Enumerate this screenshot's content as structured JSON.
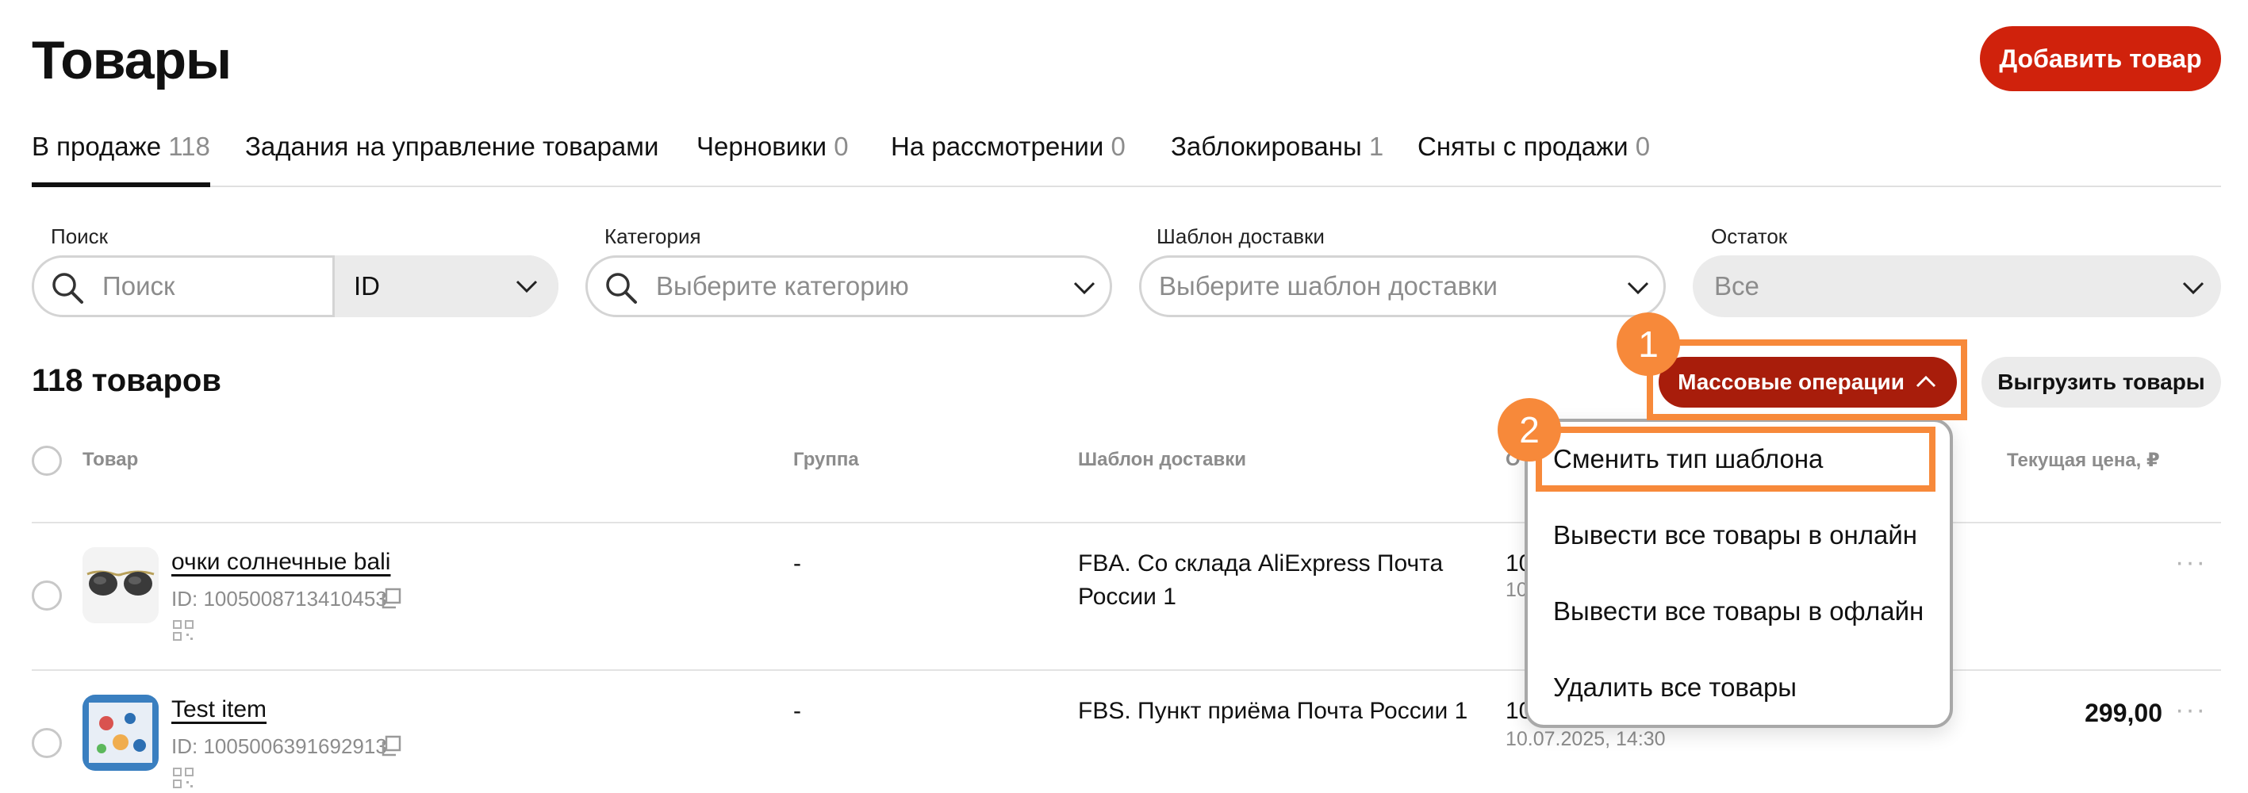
{
  "page": {
    "title": "Товары",
    "add_button": "Добавить товар"
  },
  "tabs": [
    {
      "label": "В продаже",
      "count": "118",
      "active": true
    },
    {
      "label": "Задания на управление товарами",
      "count": ""
    },
    {
      "label": "Черновики",
      "count": "0"
    },
    {
      "label": "На рассмотрении",
      "count": "0"
    },
    {
      "label": "Заблокированы",
      "count": "1"
    },
    {
      "label": "Сняты с продажи",
      "count": "0"
    }
  ],
  "filters": {
    "search": {
      "label": "Поиск",
      "placeholder": "Поиск",
      "type_value": "ID"
    },
    "category": {
      "label": "Категория",
      "placeholder": "Выберите категорию"
    },
    "delivery": {
      "label": "Шаблон доставки",
      "placeholder": "Выберите шаблон доставки"
    },
    "stock": {
      "label": "Остаток",
      "value": "Все"
    }
  },
  "summary": {
    "count_text": "118 товаров",
    "mass_ops_button": "Массовые операции",
    "export_button": "Выгрузить товары"
  },
  "table": {
    "columns": {
      "product": "Товар",
      "group": "Группа",
      "delivery": "Шаблон доставки",
      "other_partial": "О",
      "price": "Текущая цена, ₽"
    },
    "rows": [
      {
        "name": "очки солнечные bali",
        "id": "ID: 1005008713410453",
        "group": "-",
        "delivery": "FBA. Со склада AliExpress Почта России 1",
        "other_main": "10",
        "other_sub": "10",
        "price": ""
      },
      {
        "name": "Test item",
        "id": "ID: 1005006391692913",
        "group": "-",
        "delivery": "FBS. Пункт приёма Почта России 1",
        "other_main": "10",
        "other_sub": "10.07.2025, 14:30",
        "price": "299,00"
      }
    ]
  },
  "dropdown": {
    "items": [
      "Сменить тип шаблона",
      "Вывести все товары в онлайн",
      "Вывести все товары в офлайн",
      "Удалить все товары"
    ]
  },
  "annotations": {
    "badge1": "1",
    "badge2": "2",
    "accent_color": "#f7893a"
  },
  "colors": {
    "primary": "#d0220c",
    "mass_ops": "#a81d0b"
  },
  "icons": {
    "search": "magnifier-icon",
    "chevron": "chevron-down-icon",
    "copy": "copy-icon",
    "qr": "qr-code-icon",
    "more": "more-dots-icon"
  }
}
